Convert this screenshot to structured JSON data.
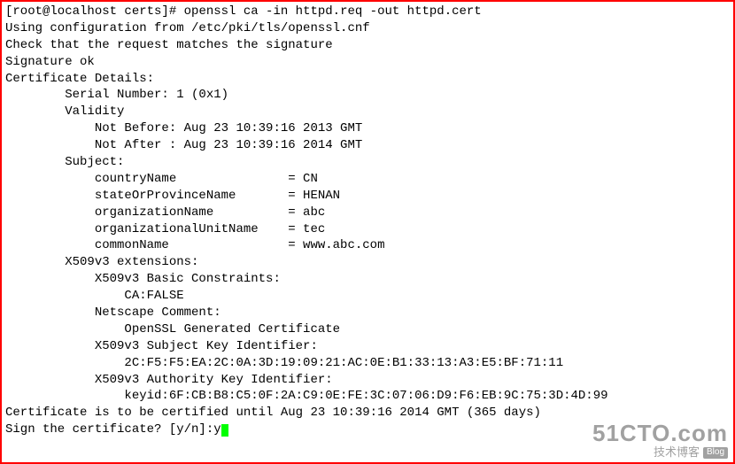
{
  "prompt": {
    "user_host": "[root@localhost certs]# ",
    "command": "openssl ca -in httpd.req -out httpd.cert"
  },
  "output": {
    "config_line": "Using configuration from /etc/pki/tls/openssl.cnf",
    "check_line": "Check that the request matches the signature",
    "sig_ok": "Signature ok",
    "cert_details_header": "Certificate Details:",
    "serial_line": "        Serial Number: 1 (0x1)",
    "validity_header": "        Validity",
    "not_before": "            Not Before: Aug 23 10:39:16 2013 GMT",
    "not_after": "            Not After : Aug 23 10:39:16 2014 GMT",
    "subject_header": "        Subject:",
    "subj_country": "            countryName               = CN",
    "subj_state": "            stateOrProvinceName       = HENAN",
    "subj_org": "            organizationName          = abc",
    "subj_ou": "            organizationalUnitName    = tec",
    "subj_cn": "            commonName                = www.abc.com",
    "x509_header": "        X509v3 extensions:",
    "basic_cons": "            X509v3 Basic Constraints: ",
    "ca_false": "                CA:FALSE",
    "netscape_h": "            Netscape Comment: ",
    "netscape_v": "                OpenSSL Generated Certificate",
    "ski_h": "            X509v3 Subject Key Identifier: ",
    "ski_v": "                2C:F5:F5:EA:2C:0A:3D:19:09:21:AC:0E:B1:33:13:A3:E5:BF:71:11",
    "aki_h": "            X509v3 Authority Key Identifier: ",
    "aki_v": "                keyid:6F:CB:B8:C5:0F:2A:C9:0E:FE:3C:07:06:D9:F6:EB:9C:75:3D:4D:99",
    "blank": "",
    "cert_until": "Certificate is to be certified until Aug 23 10:39:16 2014 GMT (365 days)",
    "sign_prompt": "Sign the certificate? [y/n]:",
    "sign_input": "y"
  },
  "watermark": {
    "big": "51CTO.com",
    "small": "技术博客",
    "blog": "Blog"
  }
}
